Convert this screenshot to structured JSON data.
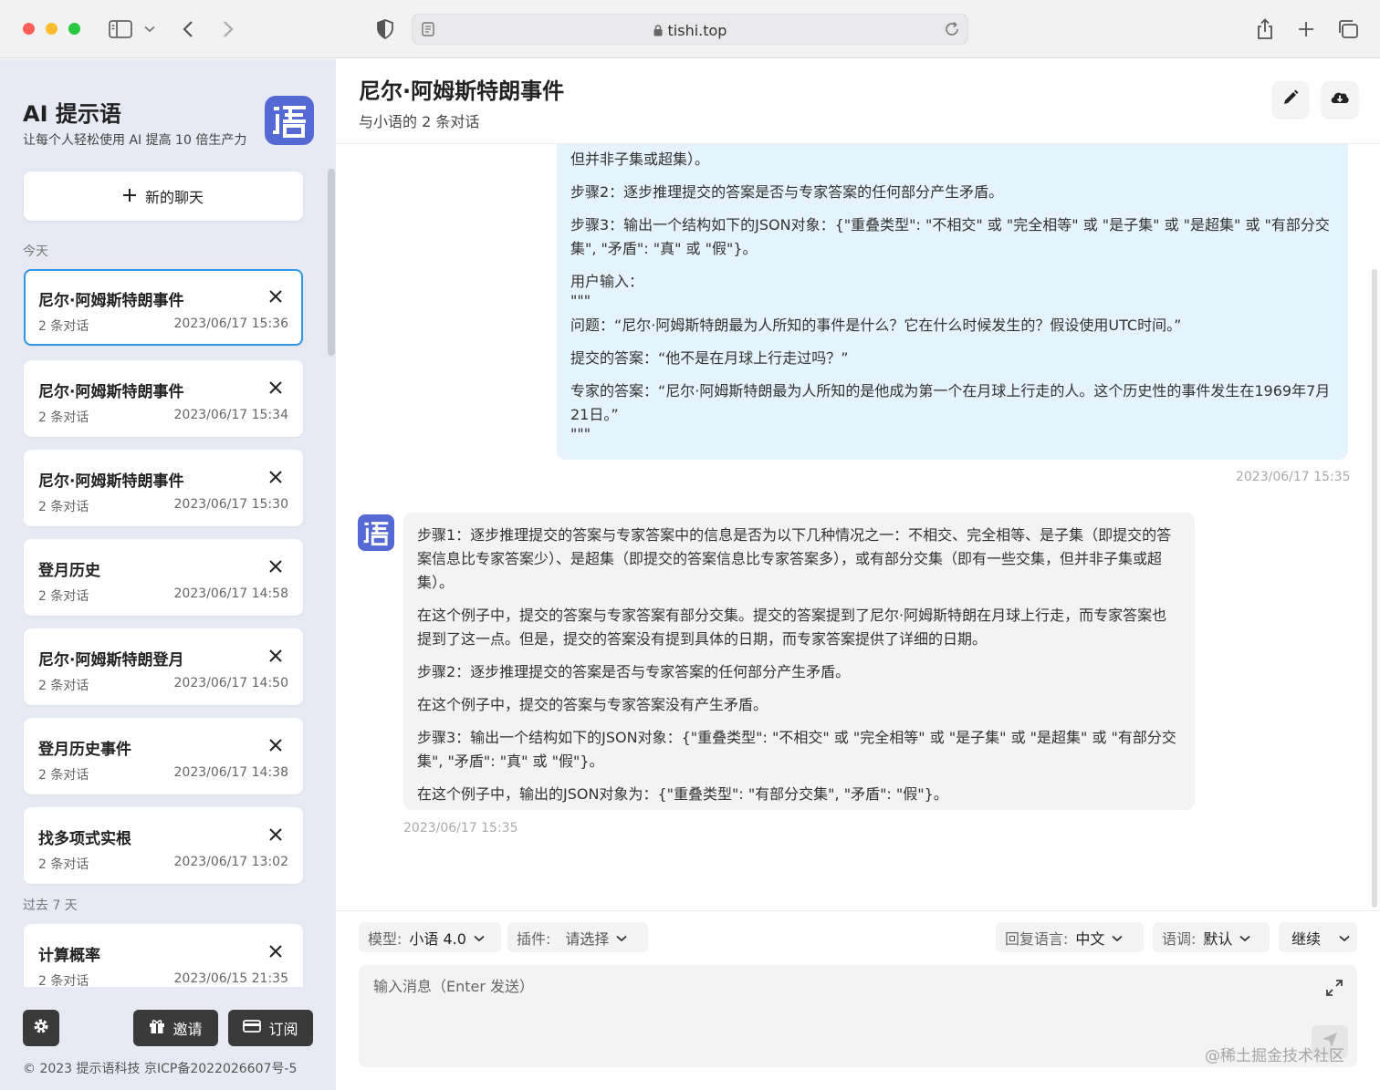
{
  "browser": {
    "url": "tishi.top"
  },
  "sidebar": {
    "brand_title": "AI 提示语",
    "brand_subtitle": "让每个人轻松使用 AI 提高 10 倍生产力",
    "new_chat_label": "新的聊天",
    "section_today": "今天",
    "section_past": "过去 7 天",
    "conversations": [
      {
        "title": "尼尔·阿姆斯特朗事件",
        "count": "2 条对话",
        "time": "2023/06/17 15:36",
        "active": true
      },
      {
        "title": "尼尔·阿姆斯特朗事件",
        "count": "2 条对话",
        "time": "2023/06/17 15:34"
      },
      {
        "title": "尼尔·阿姆斯特朗事件",
        "count": "2 条对话",
        "time": "2023/06/17 15:30"
      },
      {
        "title": "登月历史",
        "count": "2 条对话",
        "time": "2023/06/17 14:58"
      },
      {
        "title": "尼尔·阿姆斯特朗登月",
        "count": "2 条对话",
        "time": "2023/06/17 14:50"
      },
      {
        "title": "登月历史事件",
        "count": "2 条对话",
        "time": "2023/06/17 14:38"
      },
      {
        "title": "找多项式实根",
        "count": "2 条对话",
        "time": "2023/06/17 13:02"
      },
      {
        "title": "计算概率",
        "count": "2 条对话",
        "time": "2023/06/15 21:35"
      }
    ],
    "invite_label": "邀请",
    "subscribe_label": "订阅",
    "footer": "© 2023 提示语科技   京ICP备2022026607号-5"
  },
  "main": {
    "title": "尼尔·阿姆斯特朗事件",
    "subtitle": "与小语的 2 条对话",
    "user_message": [
      "但并非子集或超集）。",
      "步骤2：逐步推理提交的答案是否与专家答案的任何部分产生矛盾。",
      "步骤3：输出一个结构如下的JSON对象：{\"重叠类型\": \"不相交\" 或 \"完全相等\" 或 \"是子集\" 或 \"是超集\" 或 \"有部分交集\", \"矛盾\": \"真\" 或 \"假\"}。",
      "用户输入：",
      "\"\"\"",
      "问题：“尼尔·阿姆斯特朗最为人所知的事件是什么？它在什么时候发生的？假设使用UTC时间。”",
      "提交的答案：“他不是在月球上行走过吗？”",
      "专家的答案：“尼尔·阿姆斯特朗最为人所知的是他成为第一个在月球上行走的人。这个历史性的事件发生在1969年7月21日。”",
      "\"\"\""
    ],
    "user_time": "2023/06/17 15:35",
    "bot_message": [
      "步骤1：逐步推理提交的答案与专家答案中的信息是否为以下几种情况之一：不相交、完全相等、是子集（即提交的答案信息比专家答案少）、是超集（即提交的答案信息比专家答案多），或有部分交集（即有一些交集，但并非子集或超集）。",
      "在这个例子中，提交的答案与专家答案有部分交集。提交的答案提到了尼尔·阿姆斯特朗在月球上行走，而专家答案也提到了这一点。但是，提交的答案没有提到具体的日期，而专家答案提供了详细的日期。",
      "步骤2：逐步推理提交的答案是否与专家答案的任何部分产生矛盾。",
      "在这个例子中，提交的答案与专家答案没有产生矛盾。",
      "步骤3：输出一个结构如下的JSON对象：{\"重叠类型\": \"不相交\" 或 \"完全相等\" 或 \"是子集\" 或 \"是超集\" 或 \"有部分交集\", \"矛盾\": \"真\" 或 \"假\"}。",
      "在这个例子中，输出的JSON对象为：{\"重叠类型\": \"有部分交集\", \"矛盾\": \"假\"}。"
    ],
    "bot_time": "2023/06/17 15:35"
  },
  "controls": {
    "model_label": "模型:",
    "model_value": "小语 4.0",
    "plugin_label": "插件:",
    "plugin_value": "请选择",
    "reply_lang_label": "回复语言:",
    "reply_lang_value": "中文",
    "tone_label": "语调:",
    "tone_value": "默认",
    "continue_label": "继续",
    "input_placeholder": "输入消息（Enter 发送）"
  },
  "watermark": "@稀土掘金技术社区",
  "colors": {
    "accent": "#5469d4",
    "active_border": "#2f96e6",
    "user_bubble": "#e5f3fc",
    "bot_bubble": "#f3f3f3",
    "sidebar_bg": "#e7eaf4"
  }
}
